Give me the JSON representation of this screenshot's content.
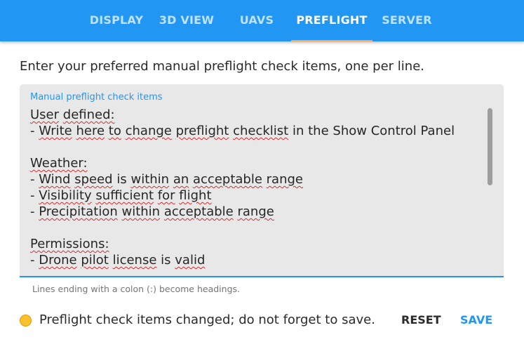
{
  "tabs": [
    {
      "label": "DISPLAY",
      "active": false
    },
    {
      "label": "3D VIEW",
      "active": false
    },
    {
      "label": "UAVS",
      "active": false
    },
    {
      "label": "PREFLIGHT",
      "active": true
    },
    {
      "label": "SERVER",
      "active": false
    }
  ],
  "instruction": "Enter your preferred manual preflight check items, one per line.",
  "checklist_field": {
    "label": "Manual preflight check items",
    "lines": [
      "User defined:",
      "- Write here to change preflight checklist in the Show Control Panel",
      "",
      "Weather:",
      "- Wind speed is within an acceptable range",
      "- Visibility sufficient for flight",
      "- Precipitation within acceptable range",
      "",
      "Permissions:",
      "- Drone pilot license is valid"
    ],
    "helper_text": "Lines ending with a colon (:) become headings."
  },
  "status": {
    "message": "Preflight check items changed; do not forget to save.",
    "indicator_color": "#fbc02d"
  },
  "actions": {
    "reset_label": "RESET",
    "save_label": "SAVE"
  },
  "colors": {
    "primary": "#2196f3",
    "tab_indicator": "#f4a460",
    "warning": "#fbc02d"
  }
}
